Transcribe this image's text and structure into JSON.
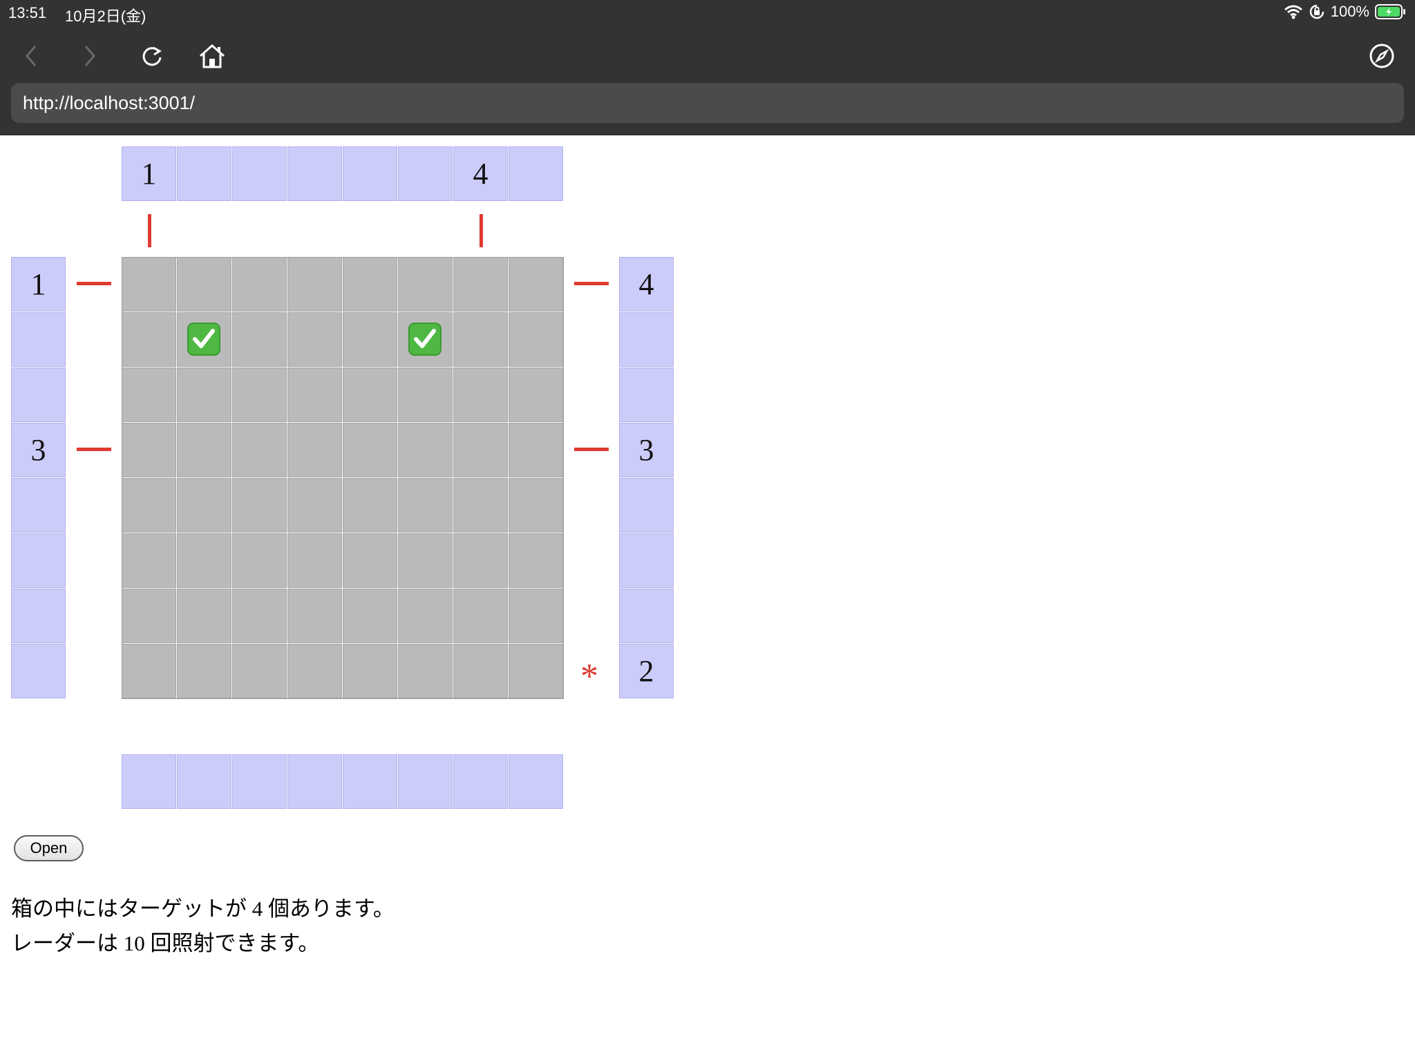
{
  "status_bar": {
    "time": "13:51",
    "date": "10月2日(金)",
    "battery": "100%"
  },
  "browser": {
    "url": "http://localhost:3001/"
  },
  "game": {
    "clues_top": [
      "1",
      "",
      "",
      "",
      "",
      "",
      "4",
      ""
    ],
    "clues_left": [
      "1",
      "",
      "",
      "3",
      "",
      "",
      "",
      ""
    ],
    "clues_right": [
      "4",
      "",
      "",
      "3",
      "",
      "",
      "",
      "2"
    ],
    "clues_bottom": [
      "",
      "",
      "",
      "",
      "",
      "",
      "",
      ""
    ],
    "checked_cells": [
      [
        1,
        1
      ],
      [
        1,
        5
      ]
    ],
    "beam_color": "#e03a30",
    "clue_color": "#ccccfa",
    "box_color": "#bababa",
    "hit_symbol": "*"
  },
  "controls": {
    "open_label": "Open"
  },
  "info": {
    "line1": "箱の中にはターゲットが 4 個あります。",
    "line2": "レーダーは 10 回照射できます。"
  }
}
